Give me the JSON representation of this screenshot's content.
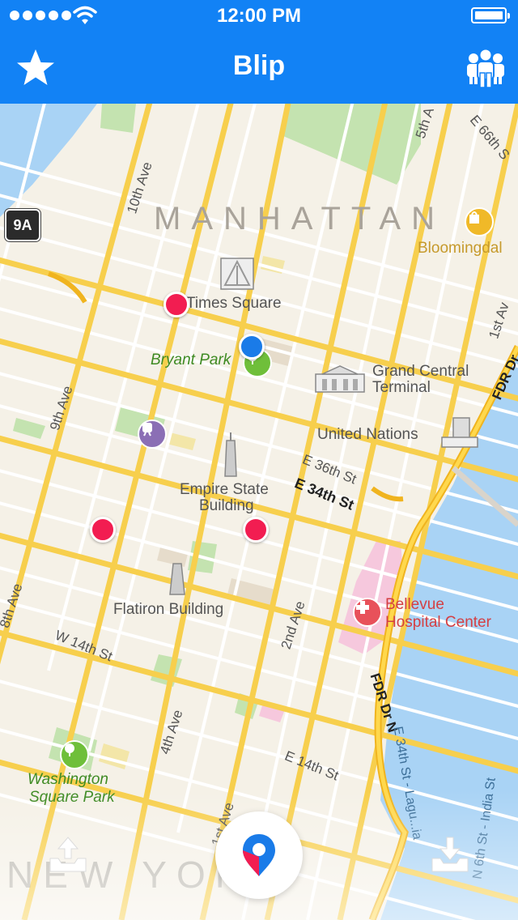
{
  "status_bar": {
    "time": "12:00 PM"
  },
  "nav_bar": {
    "title": "Blip",
    "favorites_icon": "star-icon",
    "friends_icon": "people-icon"
  },
  "map": {
    "area_label": "MANHATTAN",
    "city_label": "NEW YORK",
    "highway_shield": "9A",
    "places": {
      "times_square": "Times Square",
      "bryant_park": "Bryant Park",
      "grand_central_line1": "Grand Central",
      "grand_central_line2": "Terminal",
      "united_nations": "United Nations",
      "empire_state_line1": "Empire State",
      "empire_state_line2": "Building",
      "flatiron": "Flatiron Building",
      "bellevue_line1": "Bellevue",
      "bellevue_line2": "Hospital Center",
      "washington_sq_line1": "Washington",
      "washington_sq_line2": "Square Park",
      "bloomingdales": "Bloomingdal"
    },
    "streets": {
      "tenth_ave": "10th Ave",
      "ninth_ave": "9th Ave",
      "eighth_ave": "8th Ave",
      "fifth_ave": "5th A",
      "first_ave": "1st Av",
      "second_ave": "2nd Ave",
      "fourth_ave": "4th Ave",
      "first_ave_bottom": "1st Ave",
      "e66": "E 66th S",
      "e36": "E 36th St",
      "e34": "E 34th St",
      "w14": "W 14th St",
      "e14": "E 14th St",
      "fdr_top": "FDR Dr",
      "fdr_bottom": "FDR Dr N",
      "e34_lagu": "E 34th St - Lagu...ia",
      "n6": "N 6th St - India St"
    },
    "pins": [
      {
        "name": "times-square-pin",
        "color": "#f21d51"
      },
      {
        "name": "current-location-pin",
        "color": "#1a7be8"
      },
      {
        "name": "west-pin",
        "color": "#f21d51"
      },
      {
        "name": "murray-hill-pin",
        "color": "#f21d51"
      }
    ]
  },
  "bottom_bar": {
    "upload_icon": "upload-tray-icon",
    "drop_blip_icon": "blip-logo-icon",
    "download_icon": "download-tray-icon"
  },
  "colors": {
    "accent": "#1282f5",
    "pin_red": "#f21d51",
    "pin_blue": "#1a7be8",
    "water": "#a9d3f5",
    "park": "#c4e3b0",
    "road_major": "#f7cf4d"
  }
}
